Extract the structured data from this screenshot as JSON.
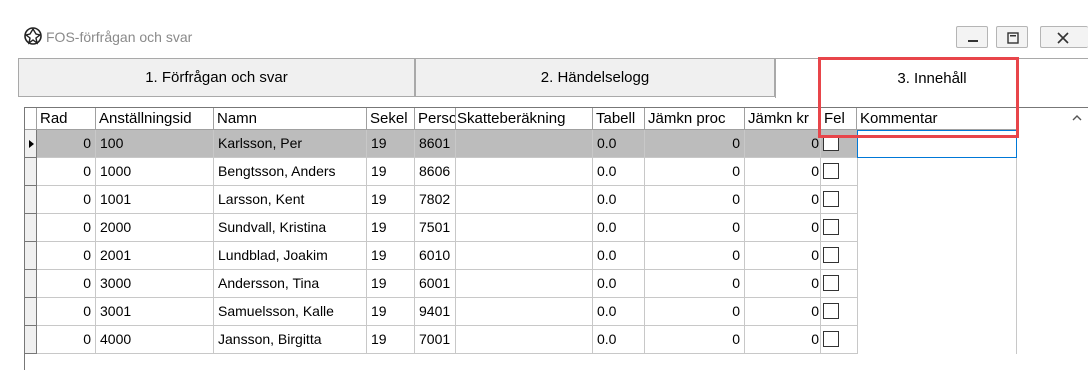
{
  "window": {
    "title": "FOS-förfrågan och svar",
    "icon": "gear-globe-icon",
    "controls": [
      "minimize-icon",
      "restore-icon",
      "close-icon"
    ]
  },
  "tabs": [
    {
      "label": "1. Förfrågan och svar",
      "active": false
    },
    {
      "label": "2. Händelselogg",
      "active": false,
      "mnemonic": "2"
    },
    {
      "label": "3. Innehåll",
      "active": true,
      "mnemonic": "3"
    }
  ],
  "grid": {
    "columns": [
      "Rad",
      "Anställningsid",
      "Namn",
      "Sekel",
      "Personnummer",
      "Skatteberäkning",
      "Tabell",
      "Jämkn proc",
      "Jämkn kr",
      "Fel",
      "Kommentar"
    ],
    "rows": [
      {
        "rad": "0",
        "id": "100",
        "namn": "Karlsson, Per",
        "sekel": "19",
        "person": "8601",
        "skatt": "",
        "tabell": "0.0",
        "proc": "0",
        "kr": "0",
        "selected": true
      },
      {
        "rad": "0",
        "id": "1000",
        "namn": "Bengtsson, Anders",
        "sekel": "19",
        "person": "8606",
        "skatt": "",
        "tabell": "0.0",
        "proc": "0",
        "kr": "0"
      },
      {
        "rad": "0",
        "id": "1001",
        "namn": "Larsson, Kent",
        "sekel": "19",
        "person": "7802",
        "skatt": "",
        "tabell": "0.0",
        "proc": "0",
        "kr": "0"
      },
      {
        "rad": "0",
        "id": "2000",
        "namn": "Sundvall, Kristina",
        "sekel": "19",
        "person": "7501",
        "skatt": "",
        "tabell": "0.0",
        "proc": "0",
        "kr": "0"
      },
      {
        "rad": "0",
        "id": "2001",
        "namn": "Lundblad, Joakim",
        "sekel": "19",
        "person": "6010",
        "skatt": "",
        "tabell": "0.0",
        "proc": "0",
        "kr": "0"
      },
      {
        "rad": "0",
        "id": "3000",
        "namn": "Andersson, Tina",
        "sekel": "19",
        "person": "6001",
        "skatt": "",
        "tabell": "0.0",
        "proc": "0",
        "kr": "0"
      },
      {
        "rad": "0",
        "id": "3001",
        "namn": "Samuelsson, Kalle",
        "sekel": "19",
        "person": "9401",
        "skatt": "",
        "tabell": "0.0",
        "proc": "0",
        "kr": "0"
      },
      {
        "rad": "0",
        "id": "4000",
        "namn": "Jansson, Birgitta",
        "sekel": "19",
        "person": "7001",
        "skatt": "",
        "tabell": "0.0",
        "proc": "0",
        "kr": "0"
      }
    ]
  },
  "annotation": {
    "color": "#e8454a"
  }
}
